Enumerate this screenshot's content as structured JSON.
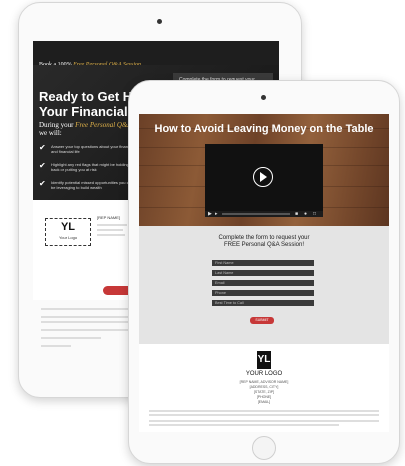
{
  "back_page": {
    "tagline_prefix": "Book a 100% ",
    "tagline_highlight": "Free Personal Q&A Session",
    "headline_line1": "Ready to Get Help",
    "headline_line2": "Your Financial Life",
    "sub_prefix": "During your ",
    "sub_highlight": "Free Personal Q&A S",
    "sub_suffix": "we will:",
    "bullets": [
      "Answer your top questions about your finances and financial life",
      "Highlight any red flags that might be holding you back or putting you at risk",
      "Identify potential missed opportunities you could be leveraging to build wealth"
    ],
    "form_prompt": "Complete the form to request your",
    "logo_text": "YL",
    "logo_caption": "Your Logo",
    "rep_name": "[REP NAME]"
  },
  "front_page": {
    "title": "How to Avoid Leaving Money on the Table",
    "cta_line1": "Complete the form to request your",
    "cta_line2": "FREE Personal Q&A Session!",
    "fields": [
      "First Name",
      "Last Name",
      "Email",
      "Phone",
      "Best Time to Call"
    ],
    "submit_label": "SUBMIT",
    "logo_mark": "YL",
    "logo_label": "YOUR LOGO",
    "address_lines": [
      "[REP NAME, ADVISOR NAME]",
      "[ADDRESS, CITY]",
      "[STATE, ZIP]",
      "[PHONE]",
      "[EMAIL]"
    ]
  },
  "colors": {
    "accent_red": "#c73838",
    "highlight_gold": "#e0b24a"
  }
}
